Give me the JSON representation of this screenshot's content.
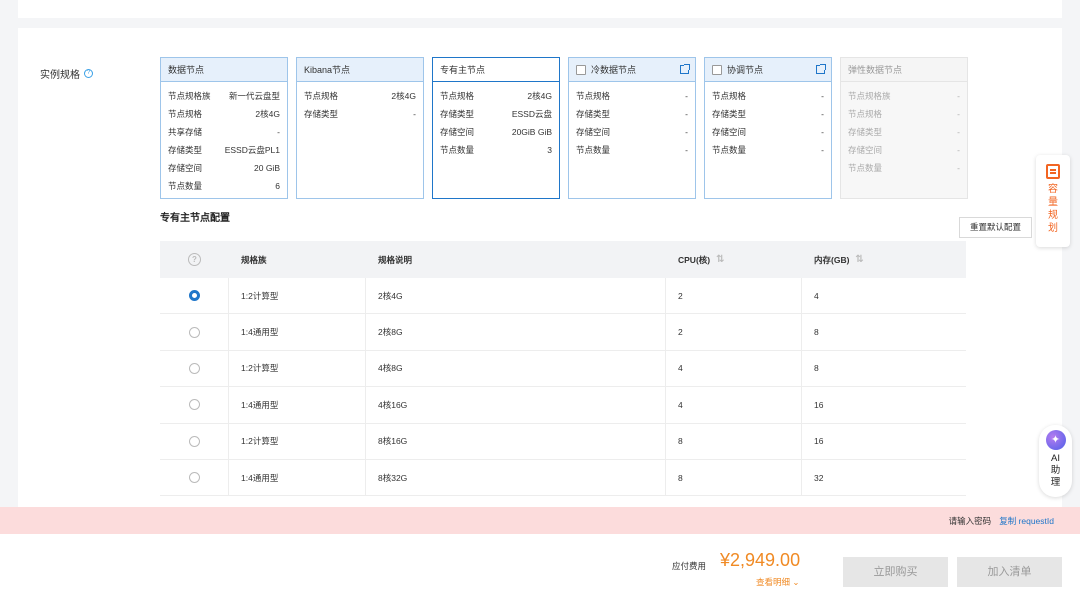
{
  "section": {
    "label": "实例规格"
  },
  "cards": [
    {
      "title": "数据节点",
      "rows": [
        [
          "节点规格族",
          "新一代云盘型"
        ],
        [
          "节点规格",
          "2核4G"
        ],
        [
          "共享存储",
          "-"
        ],
        [
          "存储类型",
          "ESSD云盘PL1"
        ],
        [
          "存储空间",
          "20 GiB"
        ],
        [
          "节点数量",
          "6"
        ]
      ]
    },
    {
      "title": "Kibana节点",
      "rows": [
        [
          "节点规格",
          "2核4G"
        ],
        [
          "存储类型",
          "-"
        ]
      ]
    },
    {
      "title": "专有主节点",
      "rows": [
        [
          "节点规格",
          "2核4G"
        ],
        [
          "存储类型",
          "ESSD云盘"
        ],
        [
          "存储空间",
          "20GiB GiB"
        ],
        [
          "节点数量",
          "3"
        ]
      ]
    },
    {
      "title": "冷数据节点",
      "rows": [
        [
          "节点规格",
          "-"
        ],
        [
          "存储类型",
          "-"
        ],
        [
          "存储空间",
          "-"
        ],
        [
          "节点数量",
          "-"
        ]
      ]
    },
    {
      "title": "协调节点",
      "rows": [
        [
          "节点规格",
          "-"
        ],
        [
          "存储类型",
          "-"
        ],
        [
          "存储空间",
          "-"
        ],
        [
          "节点数量",
          "-"
        ]
      ]
    },
    {
      "title": "弹性数据节点",
      "rows": [
        [
          "节点规格族",
          "-"
        ],
        [
          "节点规格",
          "-"
        ],
        [
          "存储类型",
          "-"
        ],
        [
          "存储空间",
          "-"
        ],
        [
          "节点数量",
          "-"
        ]
      ]
    }
  ],
  "config": {
    "subtitle": "专有主节点配置",
    "reset_label": "重置默认配置",
    "headers": [
      "规格族",
      "规格说明",
      "CPU(核)",
      "内存(GB)"
    ],
    "rows": [
      {
        "family": "1:2计算型",
        "spec": "2核4G",
        "cpu": "2",
        "mem": "4",
        "selected": true
      },
      {
        "family": "1:4通用型",
        "spec": "2核8G",
        "cpu": "2",
        "mem": "8",
        "selected": false
      },
      {
        "family": "1:2计算型",
        "spec": "4核8G",
        "cpu": "4",
        "mem": "8",
        "selected": false
      },
      {
        "family": "1:4通用型",
        "spec": "4核16G",
        "cpu": "4",
        "mem": "16",
        "selected": false
      },
      {
        "family": "1:2计算型",
        "spec": "8核16G",
        "cpu": "8",
        "mem": "16",
        "selected": false
      },
      {
        "family": "1:4通用型",
        "spec": "8核32G",
        "cpu": "8",
        "mem": "32",
        "selected": false
      }
    ]
  },
  "side": {
    "plan": "容量规划",
    "ai": "AI助理"
  },
  "error": {
    "text": "请输入密码",
    "link": "复制 requestId"
  },
  "footer": {
    "fee_label": "应付费用",
    "amount": "¥2,949.00",
    "detail": "查看明细",
    "buy": "立即购买",
    "cart": "加入清单"
  },
  "colors": {
    "primary": "#1f76c9",
    "price": "#f08a24",
    "error_bg": "#fcdcdc",
    "plan": "#f26522"
  }
}
